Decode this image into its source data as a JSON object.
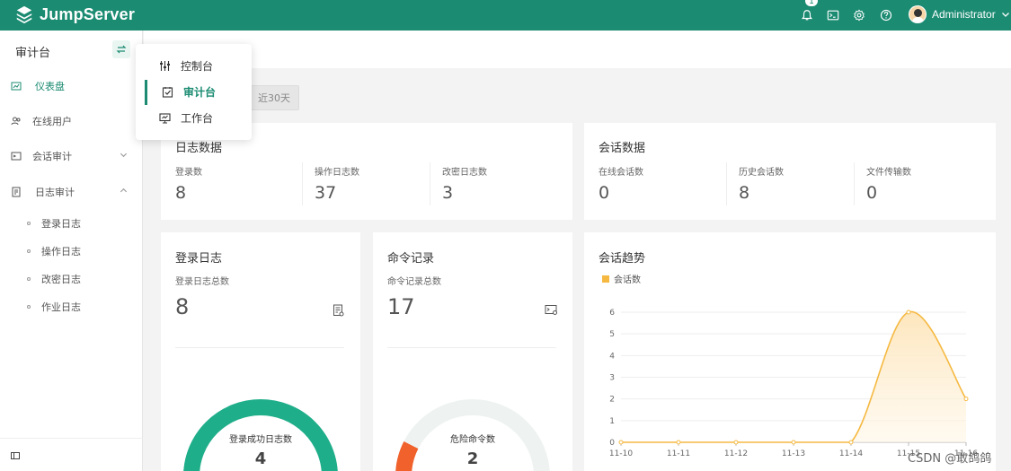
{
  "app": {
    "name": "JumpServer"
  },
  "topbar": {
    "notification_count": "1",
    "user_name": "Administrator"
  },
  "sidebar": {
    "title": "审计台",
    "switch_icon": "swap-icon",
    "items": [
      {
        "label": "仪表盘",
        "icon": "dashboard-icon",
        "active": true
      },
      {
        "label": "在线用户",
        "icon": "users-icon"
      },
      {
        "label": "会话审计",
        "icon": "session-icon",
        "expand": "collapsed"
      },
      {
        "label": "日志审计",
        "icon": "log-icon",
        "expand": "expanded"
      }
    ],
    "subitems": [
      "登录日志",
      "操作日志",
      "改密日志",
      "作业日志"
    ]
  },
  "dropdown": {
    "items": [
      {
        "label": "控制台",
        "icon": "console-icon"
      },
      {
        "label": "审计台",
        "icon": "audit-icon",
        "active": true
      },
      {
        "label": "工作台",
        "icon": "workbench-icon"
      }
    ]
  },
  "range_button": "近30天",
  "log_data": {
    "title": "日志数据",
    "stats": [
      {
        "label": "登录数",
        "value": "8"
      },
      {
        "label": "操作日志数",
        "value": "37"
      },
      {
        "label": "改密日志数",
        "value": "3"
      }
    ]
  },
  "session_data": {
    "title": "会话数据",
    "stats": [
      {
        "label": "在线会话数",
        "value": "0"
      },
      {
        "label": "历史会话数",
        "value": "8"
      },
      {
        "label": "文件传输数",
        "value": "0"
      }
    ]
  },
  "login_log": {
    "title": "登录日志",
    "total_label": "登录日志总数",
    "total_value": "8",
    "gauge_label": "登录成功日志数",
    "gauge_value": "4",
    "gauge_fraction": 1.0,
    "gauge_color": "#1fae8a"
  },
  "command_log": {
    "title": "命令记录",
    "total_label": "命令记录总数",
    "total_value": "17",
    "gauge_label": "危险命令数",
    "gauge_value": "2",
    "gauge_fraction": 0.15,
    "gauge_color": "#f0612c"
  },
  "colors": {
    "brand": "#1b8b72",
    "trend_line": "#f5b942",
    "trend_fill": "#fde6bd"
  },
  "chart_data": {
    "type": "area",
    "title": "会话趋势",
    "series": [
      {
        "name": "会话数",
        "values": [
          0,
          0,
          0,
          0,
          0,
          6,
          2
        ]
      }
    ],
    "categories": [
      "11-10",
      "11-11",
      "11-12",
      "11-13",
      "11-14",
      "11-15",
      "11-16"
    ],
    "ylim": [
      0,
      6
    ],
    "yticks": [
      "0",
      "1",
      "2",
      "3",
      "4",
      "5",
      "6"
    ],
    "legend": "top-left"
  },
  "watermark": "CSDN @敢鸽鸽"
}
